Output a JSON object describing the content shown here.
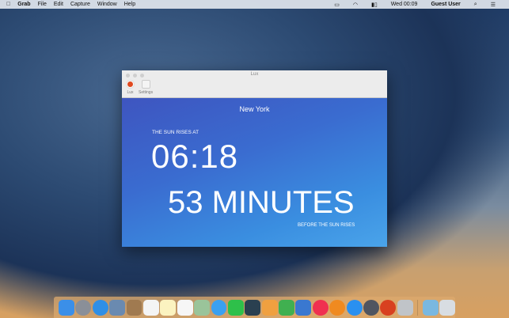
{
  "menubar": {
    "app": "Grab",
    "items": [
      "File",
      "Edit",
      "Capture",
      "Window",
      "Help"
    ],
    "clock": "Wed 00:09",
    "user": "Guest User"
  },
  "window": {
    "title": "Lux",
    "toolbar": [
      {
        "label": "Lux"
      },
      {
        "label": "Settings"
      }
    ]
  },
  "lux": {
    "city": "New York",
    "caption": "THE SUN RISES AT",
    "time": "06:18",
    "countdown": "53 MINUTES",
    "subcaption": "BEFORE THE SUN RISES"
  },
  "dock": {
    "apps": [
      {
        "name": "finder",
        "color": "#3b8fe8"
      },
      {
        "name": "launchpad",
        "color": "#8a8f98"
      },
      {
        "name": "safari",
        "color": "#2f8fe6"
      },
      {
        "name": "mail",
        "color": "#6a8ab0"
      },
      {
        "name": "contacts",
        "color": "#a07a50"
      },
      {
        "name": "calendar",
        "color": "#f4f4f4"
      },
      {
        "name": "notes",
        "color": "#fbf3c0"
      },
      {
        "name": "reminders",
        "color": "#f6f6f6"
      },
      {
        "name": "maps",
        "color": "#9ac49a"
      },
      {
        "name": "messages",
        "color": "#3aa0f0"
      },
      {
        "name": "facetime",
        "color": "#2ec04a"
      },
      {
        "name": "photo-booth",
        "color": "#2a4050"
      },
      {
        "name": "pages",
        "color": "#f0a040"
      },
      {
        "name": "numbers",
        "color": "#40b050"
      },
      {
        "name": "keynote",
        "color": "#3a78d0"
      },
      {
        "name": "itunes",
        "color": "#f03050"
      },
      {
        "name": "ibooks",
        "color": "#f08a20"
      },
      {
        "name": "app-store",
        "color": "#2a90f0"
      },
      {
        "name": "system-preferences",
        "color": "#505560"
      },
      {
        "name": "lux",
        "color": "#d84020"
      },
      {
        "name": "preview",
        "color": "#c0c4c8"
      }
    ],
    "right": [
      {
        "name": "downloads",
        "color": "#7ab8e0"
      },
      {
        "name": "trash",
        "color": "#d8dde2"
      }
    ]
  }
}
